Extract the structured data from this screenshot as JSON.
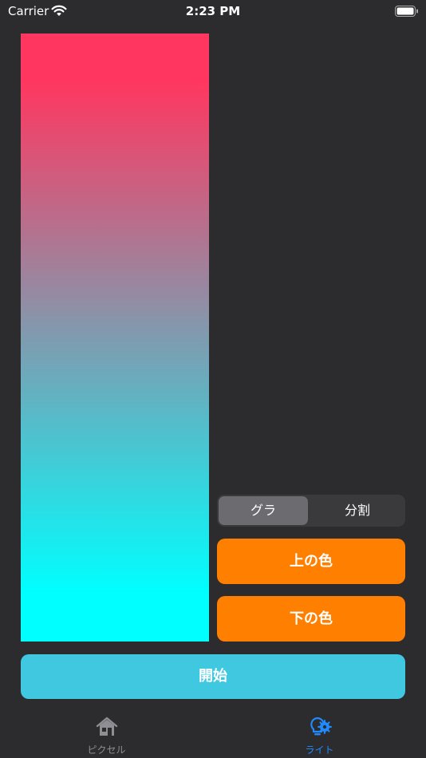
{
  "status_bar": {
    "carrier": "Carrier",
    "time": "2:23 PM"
  },
  "preview": {
    "gradient_top_color": "#ff3760",
    "gradient_bottom_color": "#00ffff"
  },
  "mode_control": {
    "options": [
      "グラ",
      "分割"
    ],
    "selected_index": 0
  },
  "buttons": {
    "top_color": "上の色",
    "bottom_color": "下の色",
    "start": "開始"
  },
  "tab_bar": {
    "tabs": [
      {
        "label": "ピクセル",
        "icon": "house-icon",
        "selected": false
      },
      {
        "label": "ライト",
        "icon": "lightbulb-gear-icon",
        "selected": true
      }
    ]
  },
  "colors": {
    "background": "#2c2c2e",
    "accent_orange": "#ff7f00",
    "start_button": "#40c8e0",
    "tab_selected": "#1f8bff",
    "tab_unselected": "#8e8e93"
  }
}
